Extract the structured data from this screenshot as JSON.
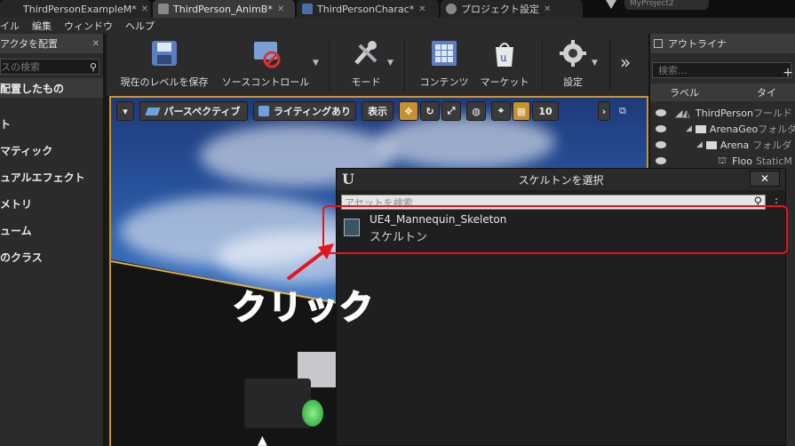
{
  "tabs": [
    {
      "label": "ThirdPersonExampleM*",
      "active": false
    },
    {
      "label": "ThirdPerson_AnimB*",
      "active": true
    },
    {
      "label": "ThirdPersonCharac*",
      "active": false
    },
    {
      "label": "プロジェクト設定",
      "active": false
    }
  ],
  "project_label": "MyProject2",
  "menu": [
    "イル",
    "編集",
    "ウィンドウ",
    "ヘルプ"
  ],
  "left_panel": {
    "title": "アクタを配置",
    "search_placeholder": "スの検索",
    "category": "配置したもの",
    "items": [
      "ト",
      "マティック",
      "ュアルエフェクト",
      "メトリ",
      "ューム",
      "のクラス"
    ]
  },
  "toolbar": {
    "save_level": "現在のレベルを保存",
    "source_control": "ソースコントロール",
    "modes": "モード",
    "content": "コンテンツ",
    "marketplace": "マーケット",
    "settings": "設定",
    "more": "»"
  },
  "viewport": {
    "perspective": "パースペクティブ",
    "lighting": "ライティングあり",
    "show": "表示",
    "grid_snap": "10"
  },
  "outliner": {
    "title": "アウトライナ",
    "search_placeholder": "検索...",
    "col_label": "ラベル",
    "col_type": "タイ",
    "rows": [
      {
        "name": "ThirdPerson",
        "type": "フールド"
      },
      {
        "name": "ArenaGeo",
        "type": "フォルダ"
      },
      {
        "name": "Arena",
        "type": "フォルダ"
      },
      {
        "name": "Floo",
        "type": "StaticM"
      }
    ]
  },
  "dialog": {
    "title": "スケルトンを選択",
    "logo": "U",
    "close": "✕",
    "search_placeholder": "アセットを検索",
    "asset_name": "UE4_Mannequin_Skeleton",
    "asset_type": "スケルトン"
  },
  "annotation": {
    "label": "クリック",
    "color": "#e8141c"
  },
  "colors": {
    "viewport_border": "#c8962a",
    "panel_bg": "#2b2b2b"
  }
}
